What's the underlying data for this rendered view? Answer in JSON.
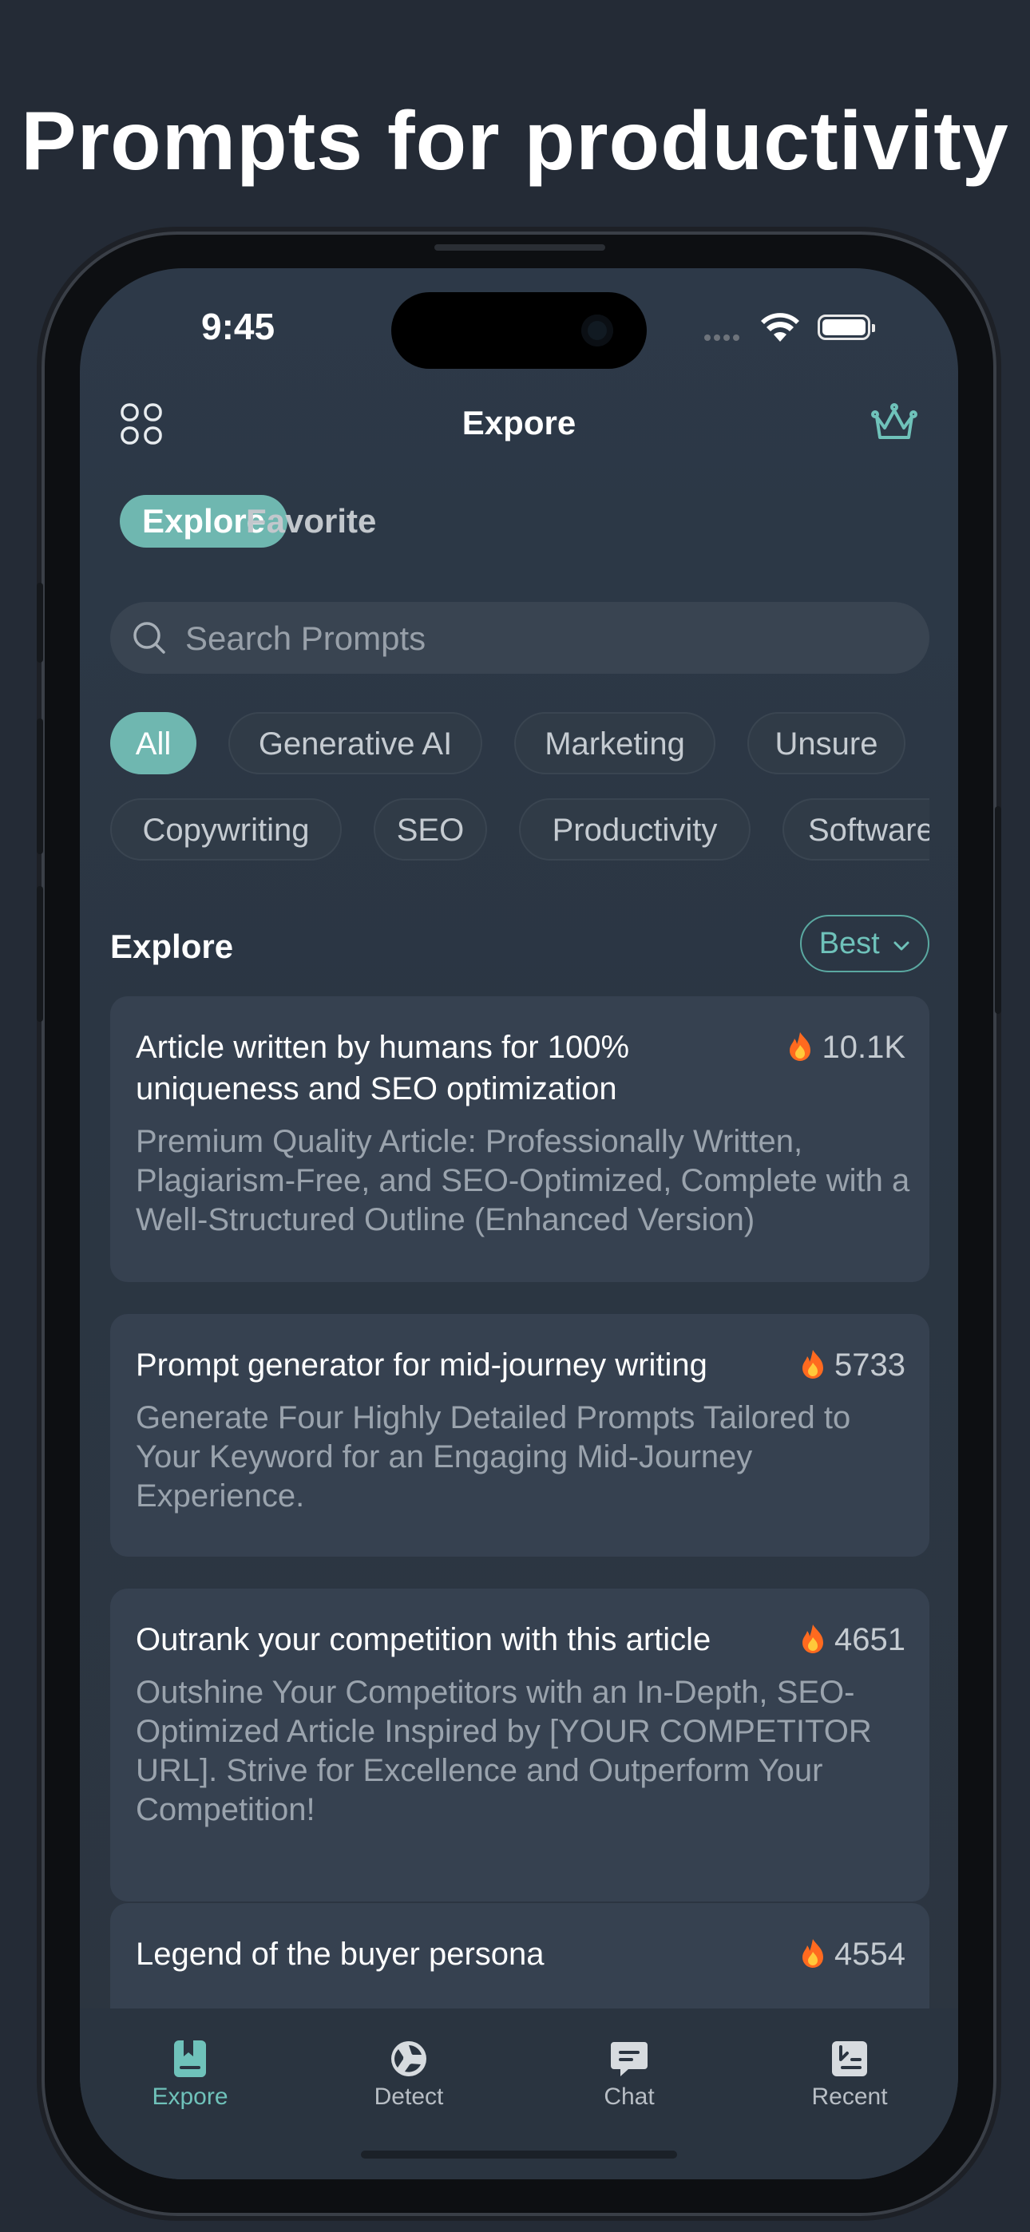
{
  "headline": "Prompts for productivity",
  "status": {
    "time": "9:45"
  },
  "nav": {
    "title": "Expore"
  },
  "tabs": [
    {
      "label": "Explore",
      "active": true
    },
    {
      "label": "Favorite",
      "active": false
    }
  ],
  "search": {
    "placeholder": "Search Prompts"
  },
  "chips_row1": [
    "All",
    "Generative AI",
    "Marketing",
    "Unsure"
  ],
  "chips_row2": [
    "Copywriting",
    "SEO",
    "Productivity",
    "Software"
  ],
  "section": {
    "title": "Explore",
    "sort_label": "Best"
  },
  "cards": [
    {
      "title": "Article written by humans for 100% uniqueness and SEO optimization",
      "count": "10.1K",
      "description": "Premium Quality Article: Professionally Written, Plagiarism-Free, and SEO-Optimized, Complete with a Well-Structured Outline (Enhanced Version)"
    },
    {
      "title": "Prompt generator for mid-journey writing",
      "count": "5733",
      "description": "Generate Four Highly Detailed Prompts Tailored to Your Keyword for an Engaging Mid-Journey Experience."
    },
    {
      "title": "Outrank your competition with this article",
      "count": "4651",
      "description": "Outshine Your Competitors with an In-Depth, SEO-Optimized Article Inspired by [YOUR COMPETITOR URL]. Strive for Excellence and Outperform Your Competition!"
    },
    {
      "title": "Legend of the buyer persona",
      "count": "4554",
      "description": ""
    }
  ],
  "tabbar": [
    {
      "label": "Expore",
      "icon": "book-icon",
      "active": true
    },
    {
      "label": "Detect",
      "icon": "detect-icon",
      "active": false
    },
    {
      "label": "Chat",
      "icon": "chat-icon",
      "active": false
    },
    {
      "label": "Recent",
      "icon": "recent-icon",
      "active": false
    }
  ],
  "colors": {
    "accent": "#6fb7b0",
    "background": "#242b36",
    "card": "#364150"
  }
}
